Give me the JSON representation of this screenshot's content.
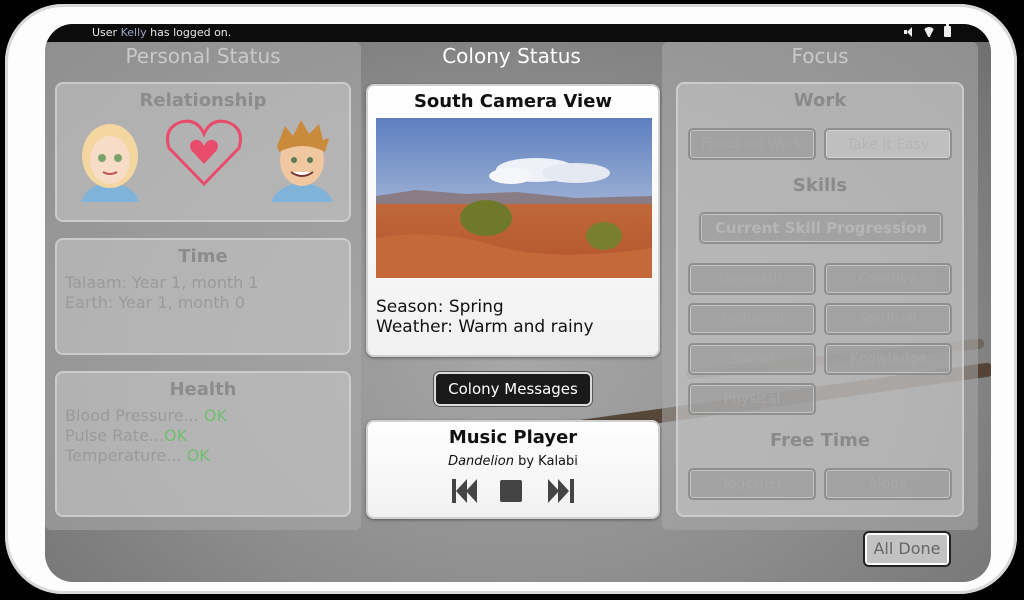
{
  "statusbar": {
    "prefix": "User",
    "user": "Kelly",
    "suffix": "has logged on.",
    "icons": [
      "speaker-icon",
      "wifi-icon",
      "battery-icon"
    ]
  },
  "left": {
    "title": "Personal Status",
    "relationship": {
      "title": "Relationship"
    },
    "time": {
      "title": "Time",
      "lines": [
        "Talaam: Year 1, month 1",
        "Earth: Year 1, month 0"
      ]
    },
    "health": {
      "title": "Health",
      "rows": [
        {
          "label": "Blood Pressure...",
          "value": "OK"
        },
        {
          "label": "Pulse Rate...",
          "value": "OK"
        },
        {
          "label": "Temperature...",
          "value": "OK"
        }
      ]
    }
  },
  "center": {
    "title": "Colony Status",
    "camera": {
      "title": "South Camera View",
      "season": "Season: Spring",
      "weather": "Weather: Warm and rainy"
    },
    "colony_messages": "Colony Messages",
    "music": {
      "title": "Music Player",
      "song": "Dandelion",
      "by": "by Kalabi"
    }
  },
  "right": {
    "title": "Focus",
    "work": {
      "title": "Work",
      "buttons": [
        "Focus on Work",
        "Take it Easy"
      ]
    },
    "skills": {
      "title": "Skills",
      "progression": "Current Skill Progression",
      "buttons": [
        "Domestic",
        "Creative",
        "Technical",
        "Spiritual",
        "Social",
        "Knowledge",
        "Physical"
      ]
    },
    "free_time": {
      "title": "Free Time",
      "buttons": [
        "Together",
        "Alone"
      ]
    }
  },
  "all_done": "All Done",
  "colors": {
    "ok": "#6fbf6f",
    "statusbar": "#0c0c0c",
    "accent": "#e94b6a"
  }
}
